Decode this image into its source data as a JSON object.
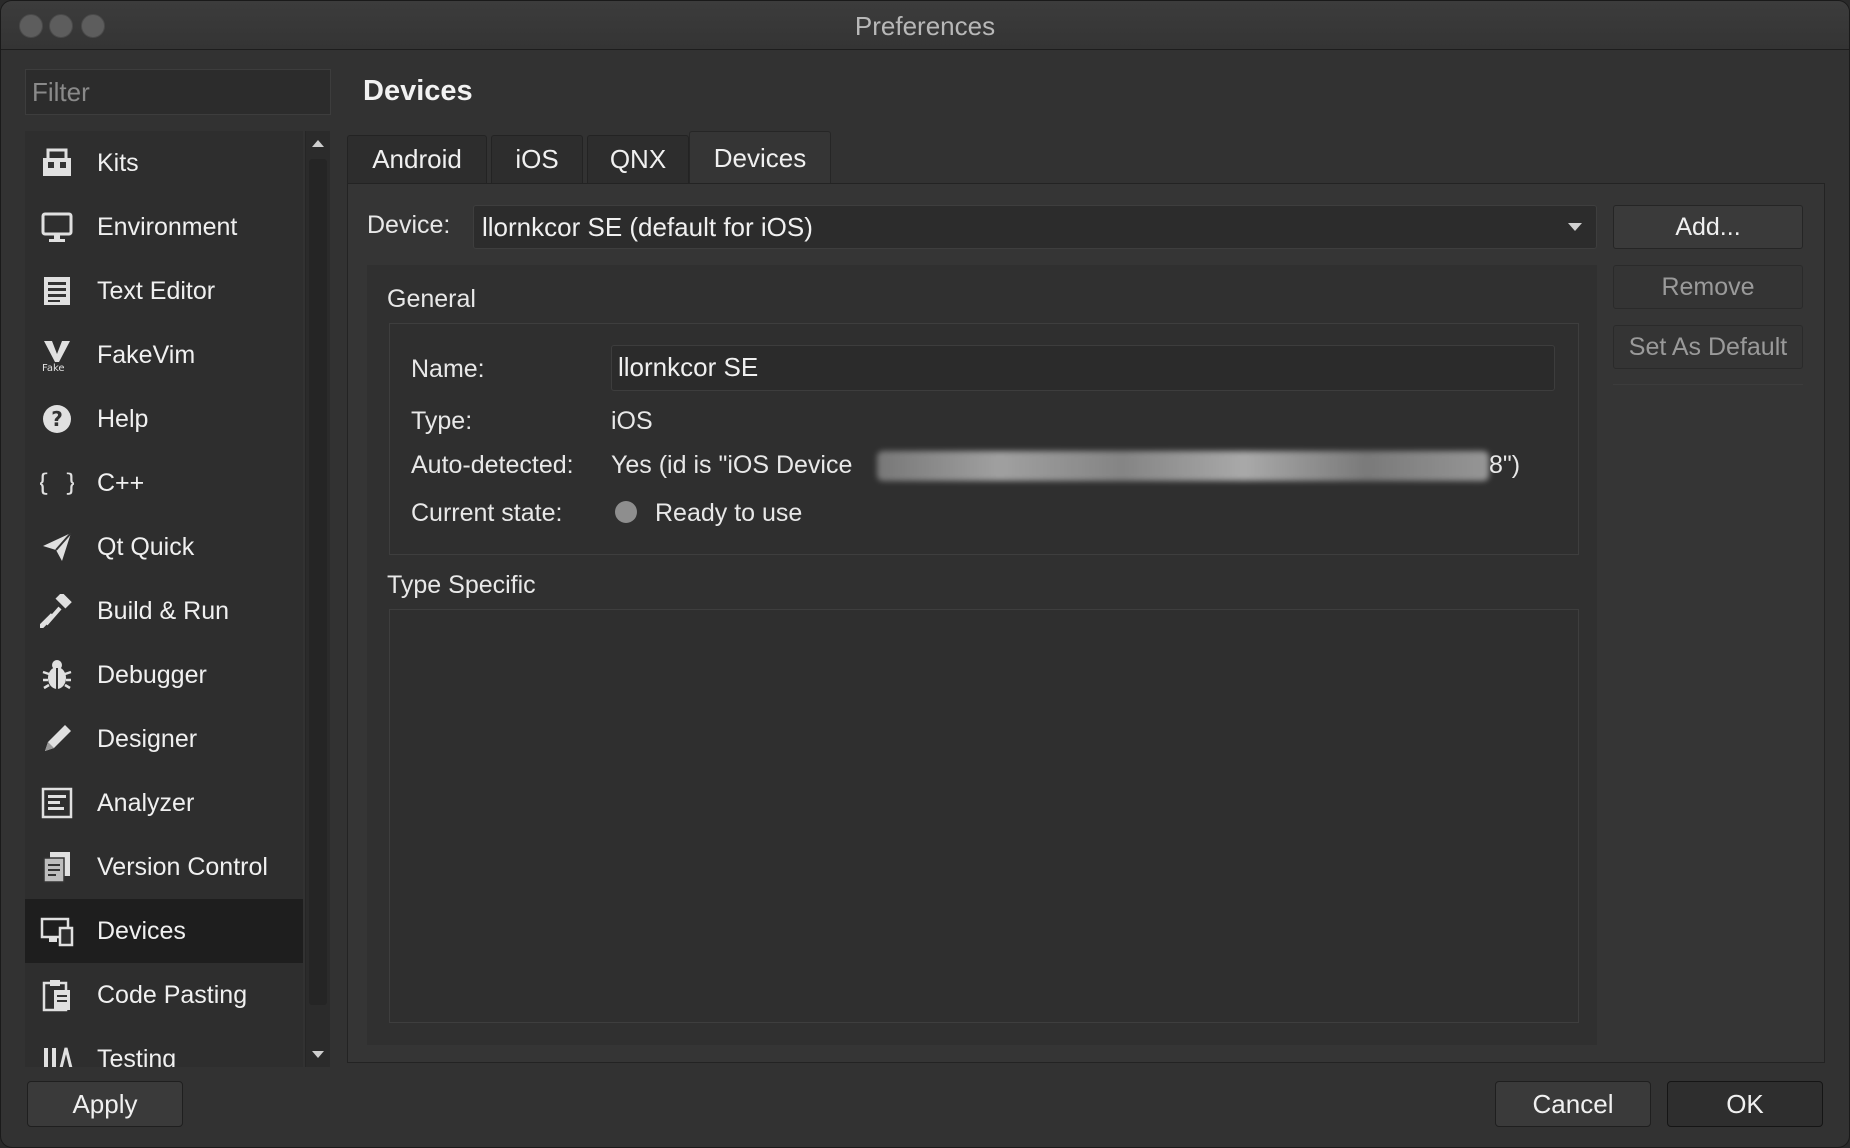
{
  "window": {
    "title": "Preferences"
  },
  "sidebar": {
    "filter_placeholder": "Filter",
    "items": [
      {
        "label": "Kits",
        "icon": "kits-icon"
      },
      {
        "label": "Environment",
        "icon": "monitor-icon"
      },
      {
        "label": "Text Editor",
        "icon": "text-editor-icon"
      },
      {
        "label": "FakeVim",
        "icon": "fakevim-icon"
      },
      {
        "label": "Help",
        "icon": "help-icon"
      },
      {
        "label": "C++",
        "icon": "braces-icon"
      },
      {
        "label": "Qt Quick",
        "icon": "paper-plane-icon"
      },
      {
        "label": "Build & Run",
        "icon": "hammer-icon"
      },
      {
        "label": "Debugger",
        "icon": "bug-icon"
      },
      {
        "label": "Designer",
        "icon": "pencil-icon"
      },
      {
        "label": "Analyzer",
        "icon": "analyzer-icon"
      },
      {
        "label": "Version Control",
        "icon": "version-control-icon"
      },
      {
        "label": "Devices",
        "icon": "devices-icon",
        "selected": true
      },
      {
        "label": "Code Pasting",
        "icon": "clipboard-icon"
      },
      {
        "label": "Testing",
        "icon": "testing-icon"
      }
    ]
  },
  "main": {
    "title": "Devices",
    "tabs": [
      {
        "label": "Android"
      },
      {
        "label": "iOS"
      },
      {
        "label": "QNX"
      },
      {
        "label": "Devices",
        "active": true
      }
    ],
    "device_label": "Device:",
    "device_value": "llornkcor SE (default for iOS)",
    "buttons": {
      "add": "Add...",
      "remove": "Remove",
      "set_default": "Set As Default"
    },
    "general": {
      "heading": "General",
      "name_label": "Name:",
      "name_value": "llornkcor SE",
      "type_label": "Type:",
      "type_value": "iOS",
      "auto_label": "Auto-detected:",
      "auto_value_prefix": "Yes (id is \"iOS Device",
      "auto_value_suffix": "8\")",
      "state_label": "Current state:",
      "state_value": "Ready to use"
    },
    "type_specific_heading": "Type Specific"
  },
  "footer": {
    "apply": "Apply",
    "cancel": "Cancel",
    "ok": "OK"
  },
  "colors": {
    "background": "#323232",
    "selected_item": "#1e1e1e",
    "status_dot": "#8e8e8e"
  }
}
